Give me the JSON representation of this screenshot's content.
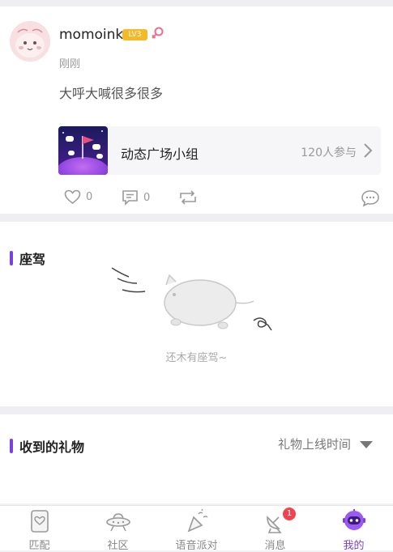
{
  "post": {
    "username": "momoink",
    "level": "LV3",
    "time": "刚刚",
    "text": "大呼大喊很多很多",
    "group": {
      "name": "动态广场小组",
      "participants": "120人参与"
    },
    "likes": "0",
    "comments": "0"
  },
  "vehicle_section": {
    "title": "座驾",
    "empty_text": "还木有座驾~"
  },
  "gifts_section": {
    "title": "收到的礼物",
    "sort_label": "礼物上线时间"
  },
  "tabbar": {
    "tabs": [
      {
        "label": "匹配",
        "icon": "match-card-icon"
      },
      {
        "label": "社区",
        "icon": "ufo-community-icon"
      },
      {
        "label": "语音派对",
        "icon": "party-horn-icon"
      },
      {
        "label": "消息",
        "icon": "satellite-message-icon",
        "badge": "1"
      },
      {
        "label": "我的",
        "icon": "astronaut-profile-icon"
      }
    ],
    "active_index": 4
  },
  "colors": {
    "accent": "#7b3fe4",
    "badge_red": "#f0434d",
    "level_gold": "#f3b928"
  }
}
